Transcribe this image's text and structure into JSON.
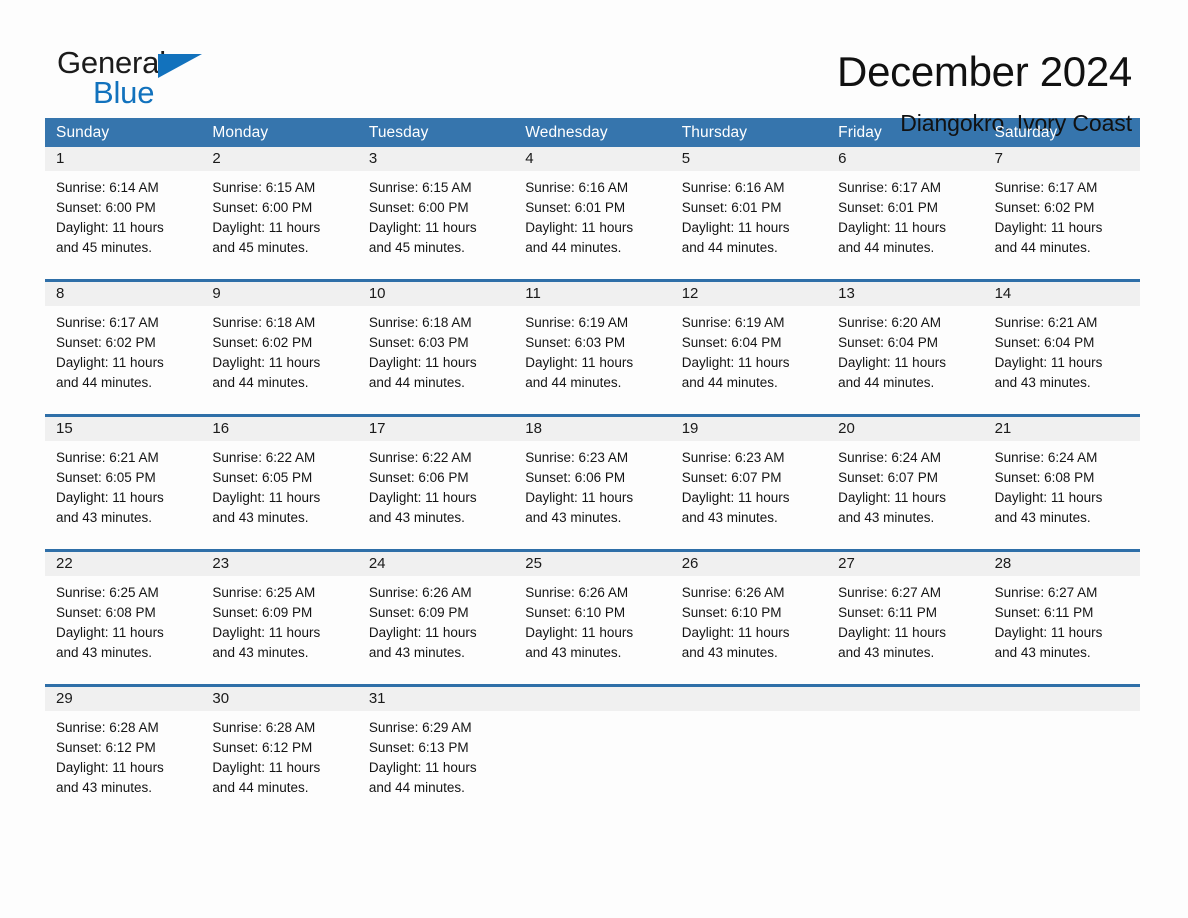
{
  "logo": {
    "word1": "General",
    "word2": "Blue",
    "triangle_color": "#1272bd",
    "icon": "triangle-icon"
  },
  "header": {
    "title": "December 2024",
    "subtitle": "Diangokro, Ivory Coast"
  },
  "theme": {
    "header_blue": "#3675ad",
    "separator_blue": "#2f6fa8",
    "daynum_bg": "#f0f0f0",
    "page_bg": "#fdfdfd",
    "text": "#141414"
  },
  "calendar": {
    "day_headers": [
      "Sunday",
      "Monday",
      "Tuesday",
      "Wednesday",
      "Thursday",
      "Friday",
      "Saturday"
    ],
    "weeks": [
      [
        {
          "day": "1",
          "lines": [
            "Sunrise: 6:14 AM",
            "Sunset: 6:00 PM",
            "Daylight: 11 hours",
            "and 45 minutes."
          ]
        },
        {
          "day": "2",
          "lines": [
            "Sunrise: 6:15 AM",
            "Sunset: 6:00 PM",
            "Daylight: 11 hours",
            "and 45 minutes."
          ]
        },
        {
          "day": "3",
          "lines": [
            "Sunrise: 6:15 AM",
            "Sunset: 6:00 PM",
            "Daylight: 11 hours",
            "and 45 minutes."
          ]
        },
        {
          "day": "4",
          "lines": [
            "Sunrise: 6:16 AM",
            "Sunset: 6:01 PM",
            "Daylight: 11 hours",
            "and 44 minutes."
          ]
        },
        {
          "day": "5",
          "lines": [
            "Sunrise: 6:16 AM",
            "Sunset: 6:01 PM",
            "Daylight: 11 hours",
            "and 44 minutes."
          ]
        },
        {
          "day": "6",
          "lines": [
            "Sunrise: 6:17 AM",
            "Sunset: 6:01 PM",
            "Daylight: 11 hours",
            "and 44 minutes."
          ]
        },
        {
          "day": "7",
          "lines": [
            "Sunrise: 6:17 AM",
            "Sunset: 6:02 PM",
            "Daylight: 11 hours",
            "and 44 minutes."
          ]
        }
      ],
      [
        {
          "day": "8",
          "lines": [
            "Sunrise: 6:17 AM",
            "Sunset: 6:02 PM",
            "Daylight: 11 hours",
            "and 44 minutes."
          ]
        },
        {
          "day": "9",
          "lines": [
            "Sunrise: 6:18 AM",
            "Sunset: 6:02 PM",
            "Daylight: 11 hours",
            "and 44 minutes."
          ]
        },
        {
          "day": "10",
          "lines": [
            "Sunrise: 6:18 AM",
            "Sunset: 6:03 PM",
            "Daylight: 11 hours",
            "and 44 minutes."
          ]
        },
        {
          "day": "11",
          "lines": [
            "Sunrise: 6:19 AM",
            "Sunset: 6:03 PM",
            "Daylight: 11 hours",
            "and 44 minutes."
          ]
        },
        {
          "day": "12",
          "lines": [
            "Sunrise: 6:19 AM",
            "Sunset: 6:04 PM",
            "Daylight: 11 hours",
            "and 44 minutes."
          ]
        },
        {
          "day": "13",
          "lines": [
            "Sunrise: 6:20 AM",
            "Sunset: 6:04 PM",
            "Daylight: 11 hours",
            "and 44 minutes."
          ]
        },
        {
          "day": "14",
          "lines": [
            "Sunrise: 6:21 AM",
            "Sunset: 6:04 PM",
            "Daylight: 11 hours",
            "and 43 minutes."
          ]
        }
      ],
      [
        {
          "day": "15",
          "lines": [
            "Sunrise: 6:21 AM",
            "Sunset: 6:05 PM",
            "Daylight: 11 hours",
            "and 43 minutes."
          ]
        },
        {
          "day": "16",
          "lines": [
            "Sunrise: 6:22 AM",
            "Sunset: 6:05 PM",
            "Daylight: 11 hours",
            "and 43 minutes."
          ]
        },
        {
          "day": "17",
          "lines": [
            "Sunrise: 6:22 AM",
            "Sunset: 6:06 PM",
            "Daylight: 11 hours",
            "and 43 minutes."
          ]
        },
        {
          "day": "18",
          "lines": [
            "Sunrise: 6:23 AM",
            "Sunset: 6:06 PM",
            "Daylight: 11 hours",
            "and 43 minutes."
          ]
        },
        {
          "day": "19",
          "lines": [
            "Sunrise: 6:23 AM",
            "Sunset: 6:07 PM",
            "Daylight: 11 hours",
            "and 43 minutes."
          ]
        },
        {
          "day": "20",
          "lines": [
            "Sunrise: 6:24 AM",
            "Sunset: 6:07 PM",
            "Daylight: 11 hours",
            "and 43 minutes."
          ]
        },
        {
          "day": "21",
          "lines": [
            "Sunrise: 6:24 AM",
            "Sunset: 6:08 PM",
            "Daylight: 11 hours",
            "and 43 minutes."
          ]
        }
      ],
      [
        {
          "day": "22",
          "lines": [
            "Sunrise: 6:25 AM",
            "Sunset: 6:08 PM",
            "Daylight: 11 hours",
            "and 43 minutes."
          ]
        },
        {
          "day": "23",
          "lines": [
            "Sunrise: 6:25 AM",
            "Sunset: 6:09 PM",
            "Daylight: 11 hours",
            "and 43 minutes."
          ]
        },
        {
          "day": "24",
          "lines": [
            "Sunrise: 6:26 AM",
            "Sunset: 6:09 PM",
            "Daylight: 11 hours",
            "and 43 minutes."
          ]
        },
        {
          "day": "25",
          "lines": [
            "Sunrise: 6:26 AM",
            "Sunset: 6:10 PM",
            "Daylight: 11 hours",
            "and 43 minutes."
          ]
        },
        {
          "day": "26",
          "lines": [
            "Sunrise: 6:26 AM",
            "Sunset: 6:10 PM",
            "Daylight: 11 hours",
            "and 43 minutes."
          ]
        },
        {
          "day": "27",
          "lines": [
            "Sunrise: 6:27 AM",
            "Sunset: 6:11 PM",
            "Daylight: 11 hours",
            "and 43 minutes."
          ]
        },
        {
          "day": "28",
          "lines": [
            "Sunrise: 6:27 AM",
            "Sunset: 6:11 PM",
            "Daylight: 11 hours",
            "and 43 minutes."
          ]
        }
      ],
      [
        {
          "day": "29",
          "lines": [
            "Sunrise: 6:28 AM",
            "Sunset: 6:12 PM",
            "Daylight: 11 hours",
            "and 43 minutes."
          ]
        },
        {
          "day": "30",
          "lines": [
            "Sunrise: 6:28 AM",
            "Sunset: 6:12 PM",
            "Daylight: 11 hours",
            "and 44 minutes."
          ]
        },
        {
          "day": "31",
          "lines": [
            "Sunrise: 6:29 AM",
            "Sunset: 6:13 PM",
            "Daylight: 11 hours",
            "and 44 minutes."
          ]
        },
        {
          "day": "",
          "lines": []
        },
        {
          "day": "",
          "lines": []
        },
        {
          "day": "",
          "lines": []
        },
        {
          "day": "",
          "lines": []
        }
      ]
    ]
  }
}
